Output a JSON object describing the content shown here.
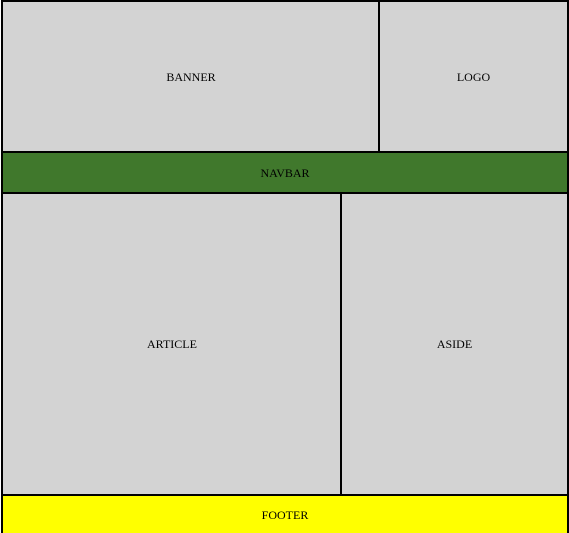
{
  "regions": {
    "banner": {
      "label": "BANNER",
      "color": "#d3d3d3"
    },
    "logo": {
      "label": "LOGO",
      "color": "#d3d3d3"
    },
    "navbar": {
      "label": "NAVBAR",
      "color": "#40782c"
    },
    "article": {
      "label": "ARTICLE",
      "color": "#d3d3d3"
    },
    "aside": {
      "label": "ASIDE",
      "color": "#d3d3d3"
    },
    "footer": {
      "label": "FOOTER",
      "color": "#ffff00"
    }
  }
}
